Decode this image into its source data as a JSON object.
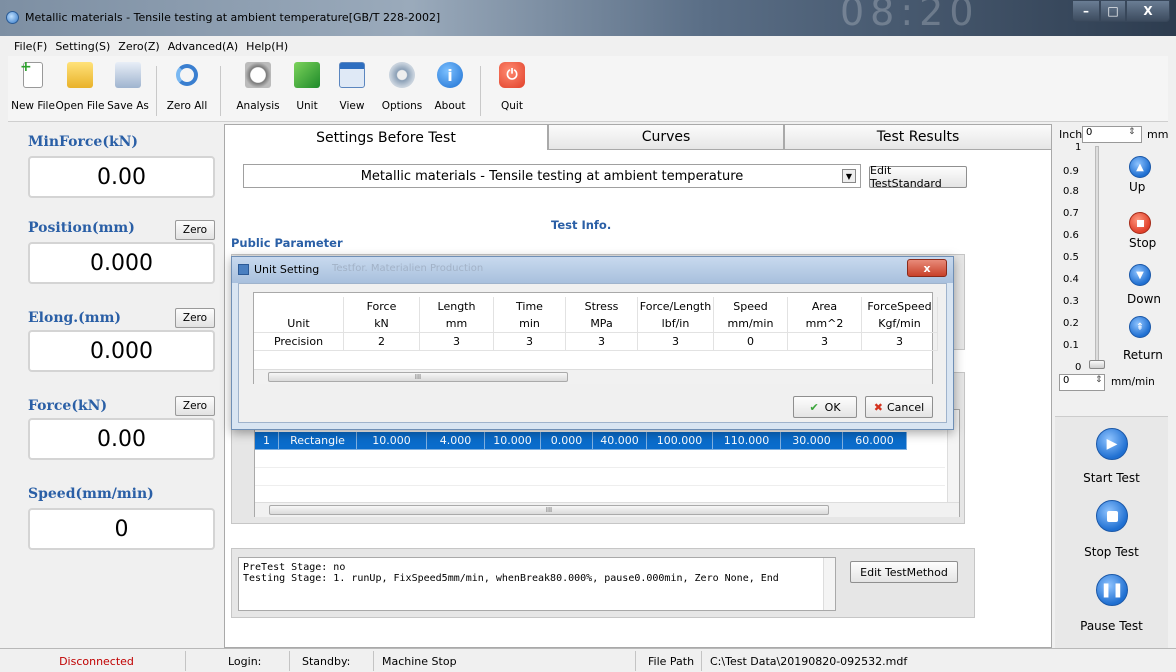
{
  "window": {
    "title": "Metallic materials - Tensile testing at ambient temperature[GB/T 228-2002]",
    "clock": "08:20"
  },
  "menu": [
    "File(F)",
    "Setting(S)",
    "Zero(Z)",
    "Advanced(A)",
    "Help(H)"
  ],
  "toolbar": [
    "New File",
    "Open File",
    "Save As",
    "Zero All",
    "Analysis",
    "Unit",
    "View",
    "Options",
    "About",
    "Quit"
  ],
  "left": {
    "minforce_label": "MinForce(kN)",
    "minforce_value": "0.00",
    "position_label": "Position(mm)",
    "position_value": "0.000",
    "elong_label": "Elong.(mm)",
    "elong_value": "0.000",
    "force_label": "Force(kN)",
    "force_value": "0.00",
    "speed_label": "Speed(mm/min)",
    "speed_value": "0",
    "zero_label": "Zero"
  },
  "tabs": [
    "Settings Before Test",
    "Curves",
    "Test Results"
  ],
  "main": {
    "standard": "Metallic materials - Tensile testing at ambient temperature",
    "edit_standard": "Edit TestStandard",
    "test_info": "Test Info.",
    "public_param": "Public Parameter",
    "specimen_row": [
      "1",
      "Rectangle",
      "10.000",
      "4.000",
      "10.000",
      "0.000",
      "40.000",
      "100.000",
      "110.000",
      "30.000",
      "60.000"
    ],
    "method_line1": "PreTest Stage: no",
    "method_line2": "Testing Stage: 1. runUp, FixSpeed5mm/min, whenBreak80.000%, pause0.000min, Zero None, End",
    "edit_method": "Edit TestMethod"
  },
  "dialog": {
    "title": "Unit Setting",
    "bg_text": "Testfor.    Materialien  Production",
    "headers": [
      "",
      "Force",
      "Length",
      "Time",
      "Stress",
      "Force/Length",
      "Speed",
      "Area",
      "ForceSpeed"
    ],
    "unit_row": [
      "Unit",
      "kN",
      "mm",
      "min",
      "MPa",
      "lbf/in",
      "mm/min",
      "mm^2",
      "Kgf/min"
    ],
    "precision_row": [
      "Precision",
      "2",
      "3",
      "3",
      "3",
      "3",
      "0",
      "3",
      "3"
    ],
    "ok": "OK",
    "cancel": "Cancel"
  },
  "right": {
    "inch": "Inch",
    "inch_value": "0",
    "mm": "mm",
    "scale": [
      "1",
      "0.9",
      "0.8",
      "0.7",
      "0.6",
      "0.5",
      "0.4",
      "0.3",
      "0.2",
      "0.1",
      "0"
    ],
    "up": "Up",
    "stop": "Stop",
    "down": "Down",
    "return": "Return",
    "speed_value": "0",
    "speed_unit": "mm/min",
    "start_test": "Start Test",
    "stop_test": "Stop Test",
    "pause_test": "Pause Test"
  },
  "status": {
    "connection": "Disconnected",
    "login": "Login:",
    "standby": "Standby:",
    "machine": "Machine Stop",
    "file_path_label": "File Path",
    "file_path": "C:\\Test Data\\20190820-092532.mdf"
  },
  "colors": {
    "accent_blue": "#2a5fa6",
    "select_blue": "#0a6ccb",
    "status_red": "#c00000",
    "quit_red": "#e0402a"
  }
}
